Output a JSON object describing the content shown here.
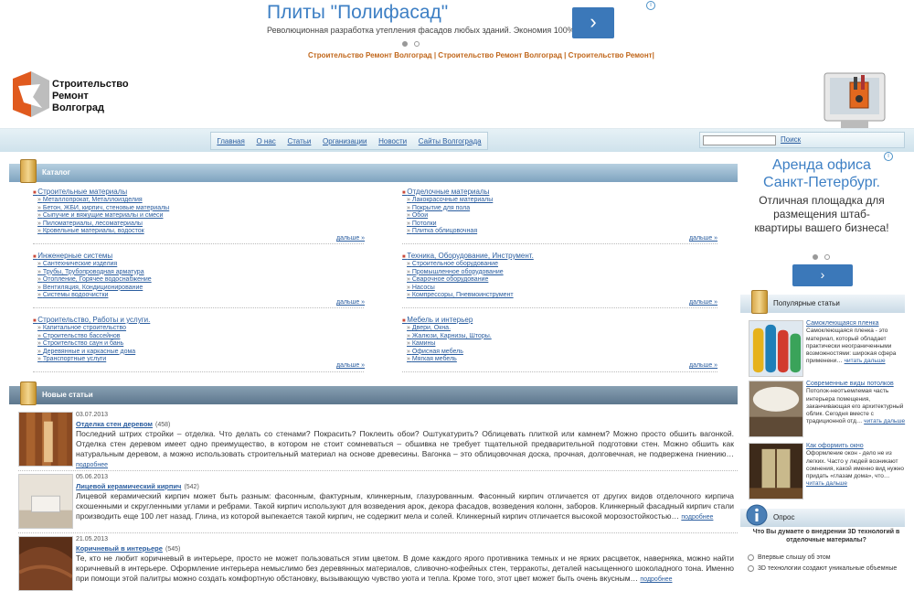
{
  "top_ad": {
    "title": "Плиты \"Полифасад\"",
    "subtitle": "Революционная разработка утепления фасадов любых зданий. Экономия 100%",
    "button": "›",
    "info": "i"
  },
  "top_links": {
    "items": [
      "Строительство Ремонт Волгоград",
      "Строительство Ремонт Волгоград",
      "Строительство Ремонт"
    ],
    "separator": " | ",
    "trailing": "|"
  },
  "logo": {
    "line1": "Строительство",
    "line2": "Ремонт",
    "line3": "Волгоград"
  },
  "nav": [
    "Главная",
    "О нас",
    "Статьи",
    "Организации",
    "Новости",
    "Сайты Волгограда"
  ],
  "search": {
    "value": "",
    "button": "Поиск"
  },
  "catalog": {
    "title": "Каталог",
    "more": "дальше »",
    "blocks": [
      {
        "title": "Строительные материалы",
        "items": [
          "Металлопрокат, Металлоизделия",
          "Бетон, ЖБИ, кирпич, стеновые материалы",
          "Сыпучие и вяжущие материалы и смеси",
          "Пиломатериалы, лесоматериалы",
          "Кровельные материалы, водосток"
        ]
      },
      {
        "title": "Отделочные материалы",
        "items": [
          "Лакокрасочные материалы",
          "Покрытие для пола",
          "Обои",
          "Потолки",
          "Плитка облицовочная"
        ]
      },
      {
        "title": "Инженерные системы",
        "items": [
          "Сантехнические изделия",
          "Трубы, Трубопроводная арматура",
          "Отопление, Горячее водоснабжение",
          "Вентиляция, Кондиционирование",
          "Системы водоочистки"
        ]
      },
      {
        "title": "Техника, Оборудование, Инструмент.",
        "items": [
          "Строительное оборудование",
          "Промышленное оборудование",
          "Сварочное оборудование",
          "Насосы",
          "Компрессоры, Пневмоинструмент"
        ]
      },
      {
        "title": "Строительство, Работы и услуги.",
        "items": [
          "Капитальное строительство",
          "Строительство бассейнов",
          "Строительство саун и бань",
          "Деревянные и каркасные дома",
          "Транспортные услуги"
        ]
      },
      {
        "title": "Мебель и интерьер",
        "items": [
          "Двери, Окна.",
          "Жалюзи, Карнизы, Шторы.",
          "Камины",
          "Офисная мебель",
          "Мягкая мебель"
        ]
      }
    ]
  },
  "news": {
    "title": "Новые статьи",
    "more": "подробнее",
    "articles": [
      {
        "date": "03.07.2013",
        "title": "Отделка стен деревом",
        "count": "(458)",
        "text": "Последний штрих стройки – отделка. Что делать со стенами? Покрасить? Поклеить обои? Оштукатурить? Облицевать плиткой или камнем? Можно просто обшить вагонкой. Отделка стен деревом имеет одно преимущество, в котором не стоит сомневаться – обшивка не требует тщательной предварительной подготовки стен. Можно обшить как натуральным деревом, а можно использовать строительный материал на основе древесины. Вагонка – это облицовочная доска, прочная, долговечная, не подвержена гниению…"
      },
      {
        "date": "05.06.2013",
        "title": "Лицевой керамический кирпич",
        "count": "(542)",
        "text": "Лицевой керамический кирпич может быть разным: фасонным, фактурным, клинкерным, глазурованным. Фасонный кирпич отличается от других видов отделочного кирпича скошенными и скругленными углами и ребрами. Такой кирпич используют для возведения арок, декора фасадов, возведения колонн, заборов. Клинкерный фасадный кирпич стали производить еще 100 лет назад. Глина, из которой выпекается такой кирпич, не содержит мела и солей. Клинкерный кирпич отличается высокой морозостойкостью…"
      },
      {
        "date": "21.05.2013",
        "title": "Коричневый в интерьере",
        "count": "(545)",
        "text": "Те, кто не любит коричневый в интерьере, просто не может пользоваться этим цветом. В доме каждого ярого противника темных и не ярких расцветок, наверняка, можно найти коричневый в интерьере. Оформление интерьера немыслимо без деревянных материалов, сливочно-кофейных стен, терракоты, деталей насыщенного шоколадного тона. Именно при помощи этой палитры можно создать комфортную обстановку, вызывающую чувство уюта и тепла. Кроме того, этот цвет может быть очень вкусным…"
      }
    ]
  },
  "right_ad": {
    "title": "Аренда офиса Санкт-Петербург.",
    "subtitle": "Отличная площадка для размещения штаб-квартиры вашего бизнеса!",
    "button": "›",
    "info": "i"
  },
  "popular": {
    "title": "Популярные статьи",
    "more": "читать дальше",
    "items": [
      {
        "title": "Самоклеющаяся пленка",
        "text": "Самоклеющаяся пленка - это материал, который обладает практически неограниченными возможностями: широкая сфера применени…"
      },
      {
        "title": "Современные виды потолков",
        "text": "Потолок-неотъемлемая часть интерьера помещения, заканчивающая его архитектурный облик. Сегодня вместе с традиционной отд…"
      },
      {
        "title": "Как оформить окно",
        "text": "Оформление окон - дело не из легких. Часто у людей возникают сомнения, какой именно вид нужно придать «глазам дома», что…"
      }
    ]
  },
  "poll": {
    "title": "Опрос",
    "question": "Что Вы думаете о внедрении 3D технологий в отделочные материалы?",
    "options": [
      "Впервые слышу об этом",
      "3D технологии создают уникальные объемные"
    ]
  },
  "colors": {
    "link": "#2a5d9f",
    "header": "#7ea3bf",
    "ad_blue": "#3b78b9",
    "orange": "#c0661a"
  }
}
